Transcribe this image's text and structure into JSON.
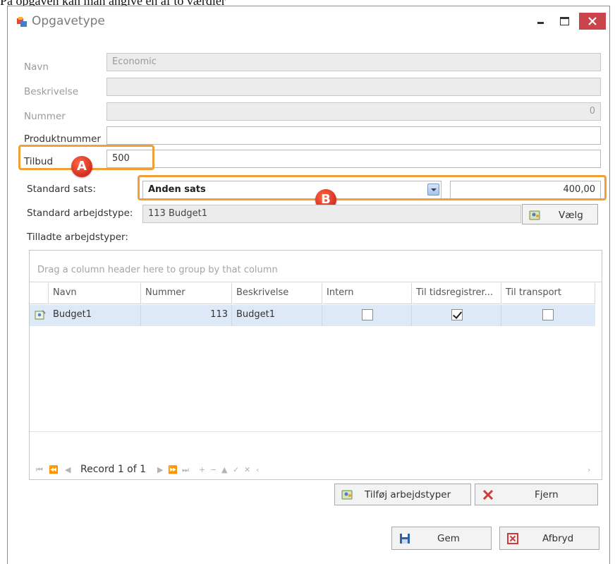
{
  "doc_caption": "Pa opgaven kan man angive en af to værdier",
  "window": {
    "title": "Opgavetype",
    "min_label": "",
    "max_label": "",
    "close_label": ""
  },
  "form": {
    "navn_label": "Navn",
    "navn_value": "Economic",
    "beskrivelse_label": "Beskrivelse",
    "beskrivelse_value": "",
    "nummer_label": "Nummer",
    "nummer_value": "0",
    "produktnummer_label": "Produktnummer",
    "produktnummer_value": "",
    "tilbud_label": "Tilbud",
    "tilbud_value": "500",
    "standard_sats_label": "Standard sats:",
    "standard_sats_value": "Anden sats",
    "standard_sats_amount": "400,00",
    "standard_arbejdstype_label": "Standard arbejdstype:",
    "standard_arbejdstype_value": "113 Budget1",
    "vaelg_label": "Vælg",
    "tilladte_label": "Tilladte arbejdstyper:"
  },
  "markers": {
    "a": "A",
    "b": "B"
  },
  "grid": {
    "group_hint": "Drag a column header here to group by that column",
    "columns": [
      "Navn",
      "Nummer",
      "Beskrivelse",
      "Intern",
      "Til tidsregistrer...",
      "Til transport"
    ],
    "rows": [
      {
        "navn": "Budget1",
        "nummer": "113",
        "beskrivelse": "Budget1",
        "intern": false,
        "til_tidsregistrering": true,
        "til_transport": false
      }
    ],
    "record_text": "Record 1 of 1"
  },
  "buttons": {
    "tilfoej": "Tilføj arbejdstyper",
    "fjern": "Fjern",
    "gem": "Gem",
    "afbryd": "Afbryd"
  },
  "colors": {
    "highlight": "#f0a037",
    "marker": "#d42d1c",
    "close": "#c9444b",
    "selected_row": "#dde9f7"
  }
}
